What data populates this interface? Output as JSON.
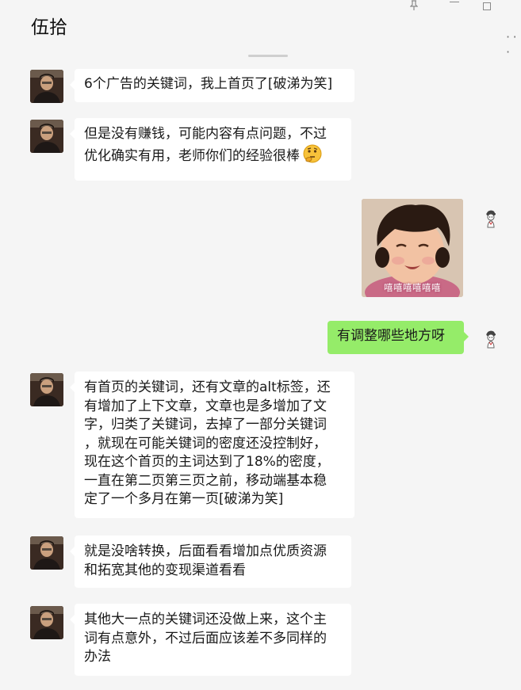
{
  "window": {
    "title": "伍拾"
  },
  "icons": {
    "pin": "pin-icon",
    "minimize": "minimize-icon",
    "maximize": "maximize-icon",
    "more": "more-icon",
    "avatar_glyph": "person-avatar",
    "thinking_emoji": "thinking-face-emoji"
  },
  "colors": {
    "background": "#f5f5f5",
    "incoming_bubble": "#ffffff",
    "outgoing_bubble": "#95ec69"
  },
  "messages": [
    {
      "sender": "other",
      "type": "text",
      "lines": [
        "6个广告的关键词，我上首页了[破涕为笑]"
      ]
    },
    {
      "sender": "other",
      "type": "text",
      "lines": [
        "但是没有赚钱，可能内容有点问题，不过",
        "优化确实有用，老师你们的经验很棒"
      ],
      "emoji": "🤔"
    },
    {
      "sender": "self",
      "type": "sticker",
      "caption": "嘻嘻嘻嘻嘻嘻"
    },
    {
      "sender": "self",
      "type": "text",
      "lines": [
        "有调整哪些地方呀"
      ]
    },
    {
      "sender": "other",
      "type": "text",
      "lines": [
        "有首页的关键词，还有文章的alt标签，还",
        "有增加了上下文章，文章也是多增加了文",
        "字，归类了关键词，去掉了一部分关键词",
        "，就现在可能关键词的密度还没控制好，",
        "现在这个首页的主词达到了18%的密度，",
        "一直在第二页第三页之前，移动端基本稳",
        "定了一个多月在第一页[破涕为笑]"
      ]
    },
    {
      "sender": "other",
      "type": "text",
      "lines": [
        "就是没啥转换，后面看看增加点优质资源",
        "和拓宽其他的变现渠道看看"
      ]
    },
    {
      "sender": "other",
      "type": "text",
      "lines": [
        "其他大一点的关键词还没做上来，这个主",
        "词有点意外，不过后面应该差不多同样的",
        "办法"
      ]
    }
  ]
}
